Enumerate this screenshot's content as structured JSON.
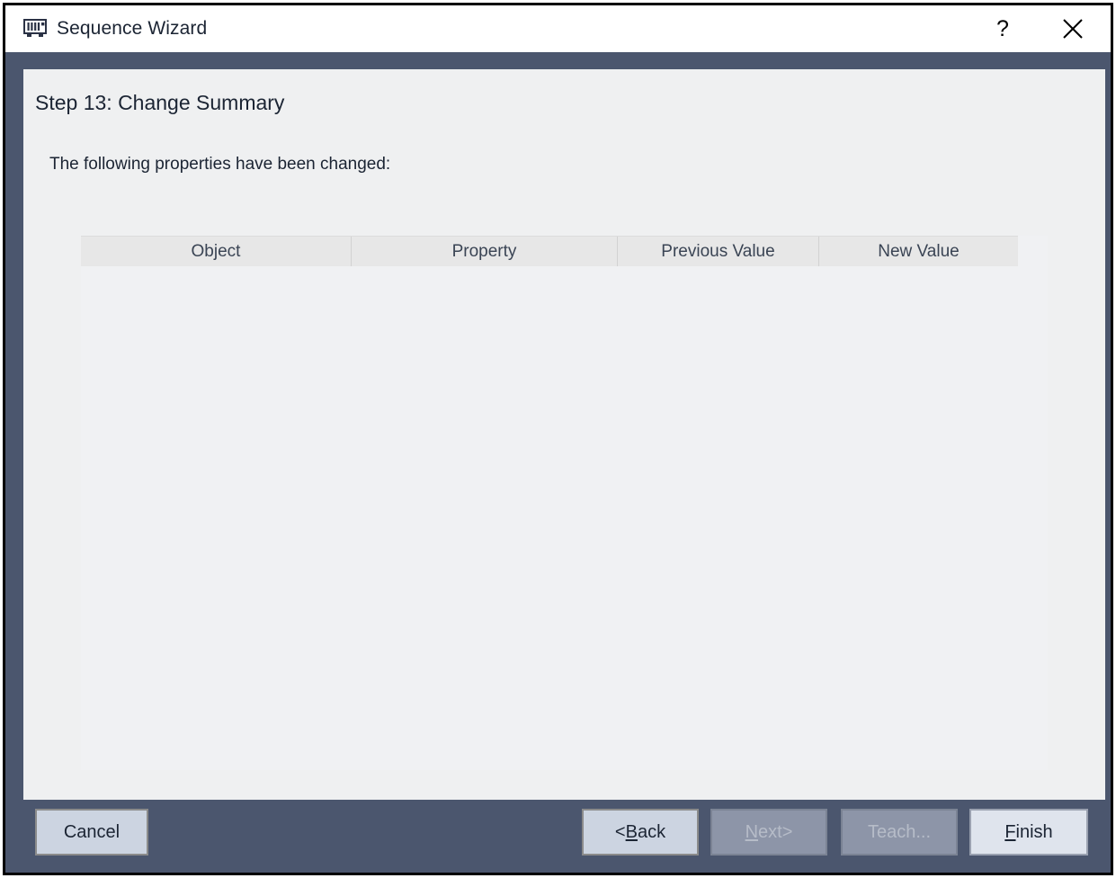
{
  "window": {
    "title": "Sequence Wizard",
    "icon": "memory-module-icon",
    "help_label": "?",
    "close_label": "×",
    "frame_color": "#4b566e",
    "panel_color": "#eff0f1"
  },
  "page": {
    "step_title": "Step 13: Change Summary",
    "intro_text": "The following properties have been changed:"
  },
  "table": {
    "columns": [
      "Object",
      "Property",
      "Previous Value",
      "New Value"
    ],
    "rows": []
  },
  "footer": {
    "cancel": {
      "label": "Cancel",
      "enabled": true
    },
    "back": {
      "prefix": "< ",
      "accel": "B",
      "rest": "ack",
      "enabled": true
    },
    "next": {
      "accel": "N",
      "rest": "ext",
      "suffix": " >",
      "enabled": false
    },
    "teach": {
      "label": "Teach...",
      "enabled": false
    },
    "finish": {
      "accel": "F",
      "rest": "inish",
      "enabled": true
    }
  }
}
